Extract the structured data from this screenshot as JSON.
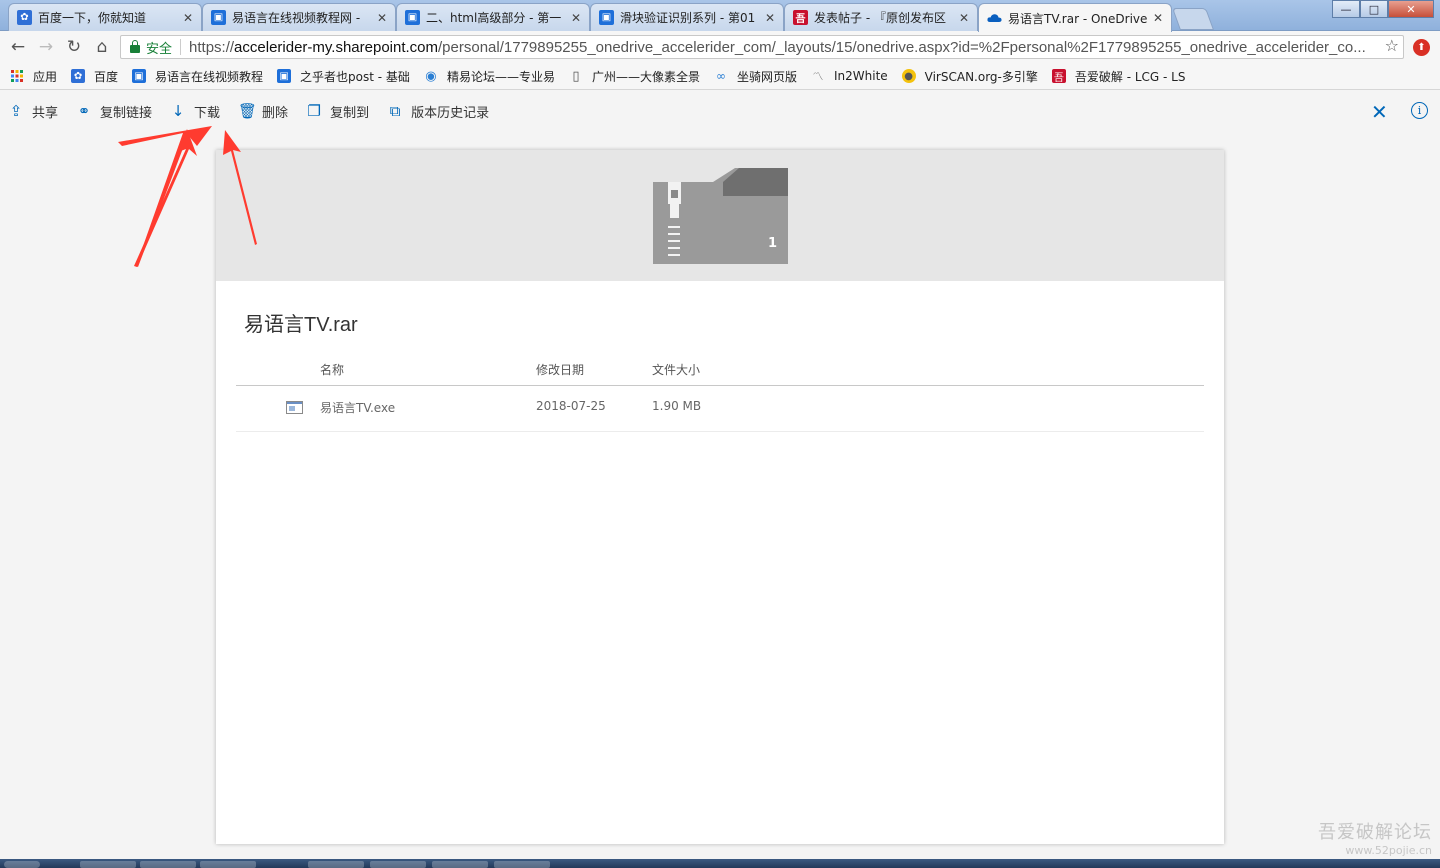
{
  "browser": {
    "tabs": [
      {
        "title": "百度一下，你就知道",
        "icon": "baidu-paw-icon",
        "color": "#2f6fd6"
      },
      {
        "title": "易语言在线视频教程网 - ",
        "icon": "tv-icon",
        "color": "#1e6fd9"
      },
      {
        "title": "二、html高级部分 - 第一",
        "icon": "tv-icon",
        "color": "#1e6fd9"
      },
      {
        "title": "滑块验证识别系列 - 第01",
        "icon": "tv-icon",
        "color": "#1e6fd9"
      },
      {
        "title": "发表帖子 - 『原创发布区",
        "icon": "52pojie-icon",
        "color": "#c8102e"
      },
      {
        "title": "易语言TV.rar - OneDrive",
        "icon": "onedrive-cloud-icon",
        "color": "#0a5fbf"
      }
    ],
    "window_buttons": {
      "minimize": "—",
      "maximize": "□",
      "close": "✕"
    },
    "address": {
      "secure_label": "安全",
      "url_scheme": "https://",
      "url_host": "accelerider-my.sharepoint.com",
      "url_path": "/personal/1779895255_onedrive_accelerider_com/_layouts/15/onedrive.aspx?id=%2Fpersonal%2F1779895255_onedrive_accelerider_co..."
    },
    "bookmarks": [
      {
        "label": "应用",
        "icon": "apps-grid-icon"
      },
      {
        "label": "百度",
        "icon": "baidu-paw-icon"
      },
      {
        "label": "易语言在线视频教程",
        "icon": "tv-icon"
      },
      {
        "label": "之乎者也post - 基础",
        "icon": "tv-icon"
      },
      {
        "label": "精易论坛——专业易",
        "icon": "eye-icon"
      },
      {
        "label": "广州——大像素全景",
        "icon": "page-icon"
      },
      {
        "label": "坐骑网页版",
        "icon": "link-icon"
      },
      {
        "label": "In2White",
        "icon": "chart-icon"
      },
      {
        "label": "VirSCAN.org-多引擎",
        "icon": "bulb-icon"
      },
      {
        "label": "吾爱破解 - LCG - LS",
        "icon": "52pojie-icon"
      }
    ]
  },
  "commands": [
    {
      "label": "共享",
      "icon": "share-icon",
      "glyph": "⇪"
    },
    {
      "label": "复制链接",
      "icon": "link-icon",
      "glyph": "⚭"
    },
    {
      "label": "下载",
      "icon": "download-icon",
      "glyph": "↓"
    },
    {
      "label": "删除",
      "icon": "trash-icon",
      "glyph": "🗑"
    },
    {
      "label": "复制到",
      "icon": "copy-icon",
      "glyph": "❐"
    },
    {
      "label": "版本历史记录",
      "icon": "history-icon",
      "glyph": "⧉"
    }
  ],
  "preview": {
    "archive_count": "1",
    "file_name": "易语言TV.rar",
    "columns": {
      "name": "名称",
      "modified": "修改日期",
      "size": "文件大小"
    },
    "rows": [
      {
        "name": "易语言TV.exe",
        "modified": "2018-07-25",
        "size": "1.90 MB"
      }
    ]
  },
  "watermark": {
    "line1": "吾爱破解论坛",
    "line2": "www.52pojie.cn"
  },
  "colors": {
    "accent": "#0067b8",
    "annotation": "#ff3b2f",
    "secure": "#188038"
  }
}
